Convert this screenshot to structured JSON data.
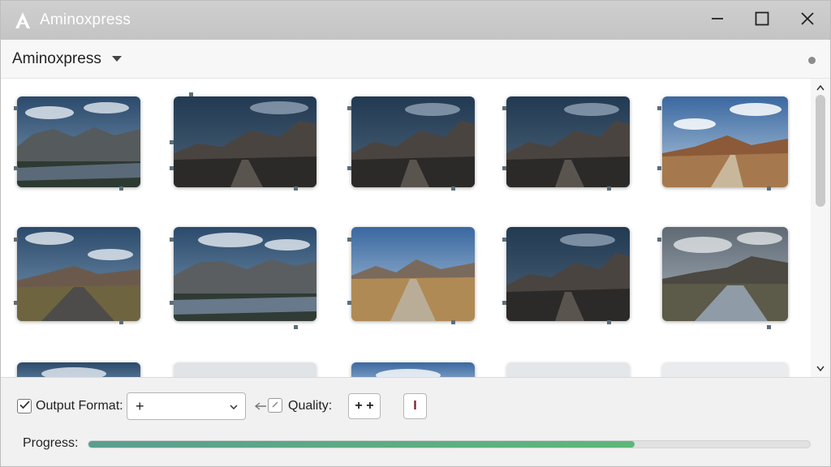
{
  "window": {
    "title": "Aminoxpress"
  },
  "toolbar": {
    "title": "Aminoxpress"
  },
  "footer": {
    "output_format_label": "Output Format:",
    "output_format_value": "+",
    "quality_label": "Quality:",
    "quality_value": "+ +",
    "extra_button_value": "I",
    "progress_label": "Progress:",
    "progress_fraction": 0.757
  },
  "colors": {
    "accent": "#5cb878",
    "progress_start": "#5a9e8f"
  },
  "icons": [
    "app-logo-icon",
    "minimize-icon",
    "maximize-icon",
    "close-icon",
    "chevron-down-icon",
    "checkbox-check-icon",
    "arrow-left-icon",
    "pencil-icon",
    "scroll-up-icon",
    "scroll-down-icon"
  ]
}
